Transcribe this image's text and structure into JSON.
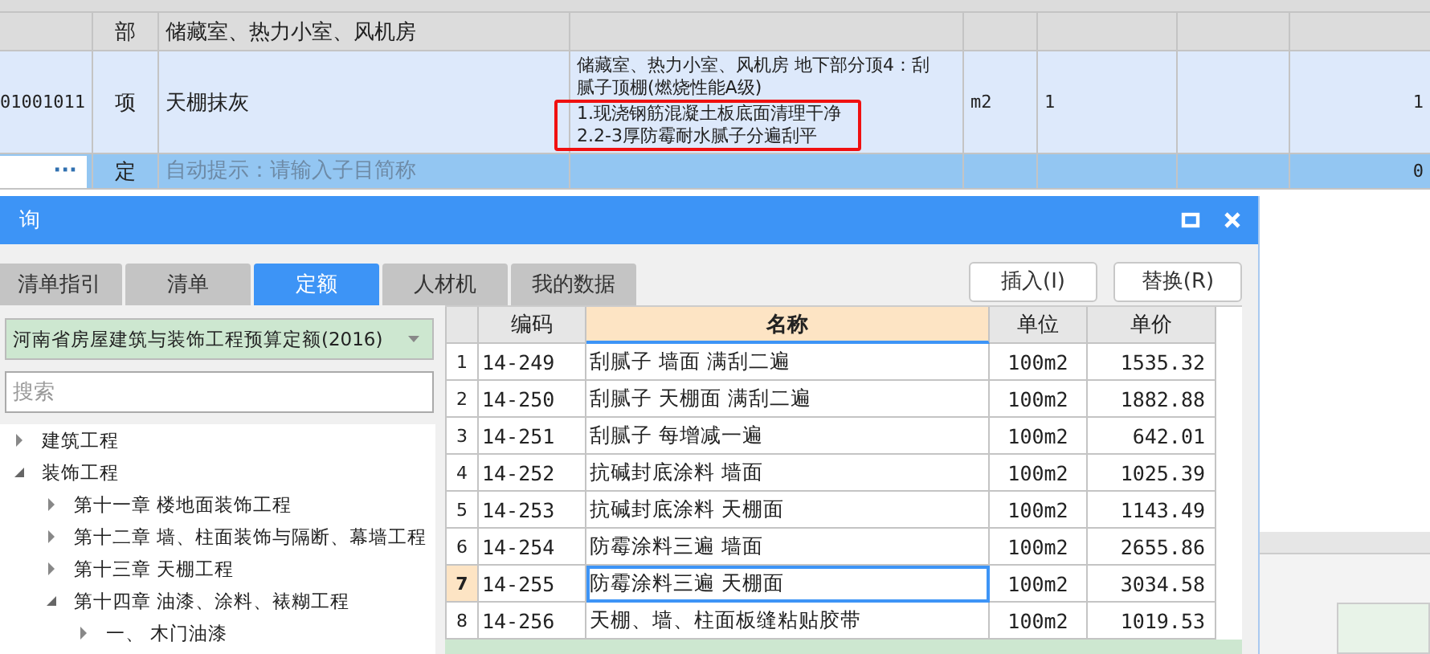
{
  "sheet": {
    "rows": [
      {
        "kind": "part",
        "type": "部",
        "name": "储藏室、热力小室、风机房"
      },
      {
        "kind": "item",
        "code": "01001011",
        "type": "项",
        "name": "天棚抹灰",
        "description": [
          {
            "text": "储藏室、热力小室、风机房 地下部分顶4：刮",
            "marked": false
          },
          {
            "text": "腻子顶棚(燃烧性能A级)",
            "marked": false
          },
          {
            "text": "1.现浇钢筋混凝土板底面清理干净",
            "marked": true
          },
          {
            "text": "2.2-3厚防霉耐水腻子分遍刮平",
            "marked": true
          }
        ],
        "unit": "m2",
        "quantity": "1",
        "total": "1"
      },
      {
        "kind": "entry",
        "type": "定",
        "placeholder": "自动提示：请输入子目简称",
        "button": "···",
        "total": "0"
      }
    ]
  },
  "dialog": {
    "title": "询",
    "tabs": [
      {
        "label": "清单指引",
        "selected": false
      },
      {
        "label": "清单",
        "selected": false
      },
      {
        "label": "定额",
        "selected": true
      },
      {
        "label": "人材机",
        "selected": false
      },
      {
        "label": "我的数据",
        "selected": false
      }
    ],
    "buttons": [
      "插入(I)",
      "替换(R)"
    ],
    "library": "河南省房屋建筑与装饰工程预算定额(2016)",
    "search": {
      "placeholder": "搜索"
    },
    "tree": [
      {
        "label": "建筑工程",
        "expanded": false
      },
      {
        "label": "装饰工程",
        "expanded": true,
        "children": [
          {
            "label": "第十一章 楼地面装饰工程",
            "expanded": false
          },
          {
            "label": "第十二章 墙、柱面装饰与隔断、幕墙工程",
            "expanded": false
          },
          {
            "label": "第十三章 天棚工程",
            "expanded": false
          },
          {
            "label": "第十四章 油漆、涂料、裱糊工程",
            "expanded": true,
            "children": [
              {
                "label": "一、 木门油漆",
                "expanded": false
              }
            ]
          }
        ]
      }
    ],
    "table": {
      "columns": [
        "编码",
        "名称",
        "单位",
        "单价"
      ],
      "rows": [
        {
          "no": "1",
          "code": "14-249",
          "name": "刮腻子 墙面 满刮二遍",
          "unit": "100m2",
          "price": "1535.32",
          "selected": false
        },
        {
          "no": "2",
          "code": "14-250",
          "name": "刮腻子 天棚面 满刮二遍",
          "unit": "100m2",
          "price": "1882.88",
          "selected": false
        },
        {
          "no": "3",
          "code": "14-251",
          "name": "刮腻子 每增减一遍",
          "unit": "100m2",
          "price": "642.01",
          "selected": false
        },
        {
          "no": "4",
          "code": "14-252",
          "name": "抗碱封底涂料 墙面",
          "unit": "100m2",
          "price": "1025.39",
          "selected": false
        },
        {
          "no": "5",
          "code": "14-253",
          "name": "抗碱封底涂料 天棚面",
          "unit": "100m2",
          "price": "1143.49",
          "selected": false
        },
        {
          "no": "6",
          "code": "14-254",
          "name": "防霉涂料三遍 墙面",
          "unit": "100m2",
          "price": "2655.86",
          "selected": false
        },
        {
          "no": "7",
          "code": "14-255",
          "name": "防霉涂料三遍 天棚面",
          "unit": "100m2",
          "price": "3034.58",
          "selected": true
        },
        {
          "no": "8",
          "code": "14-256",
          "name": "天棚、墙、柱面板缝粘贴胶带",
          "unit": "100m2",
          "price": "1019.53",
          "selected": false
        }
      ]
    }
  }
}
